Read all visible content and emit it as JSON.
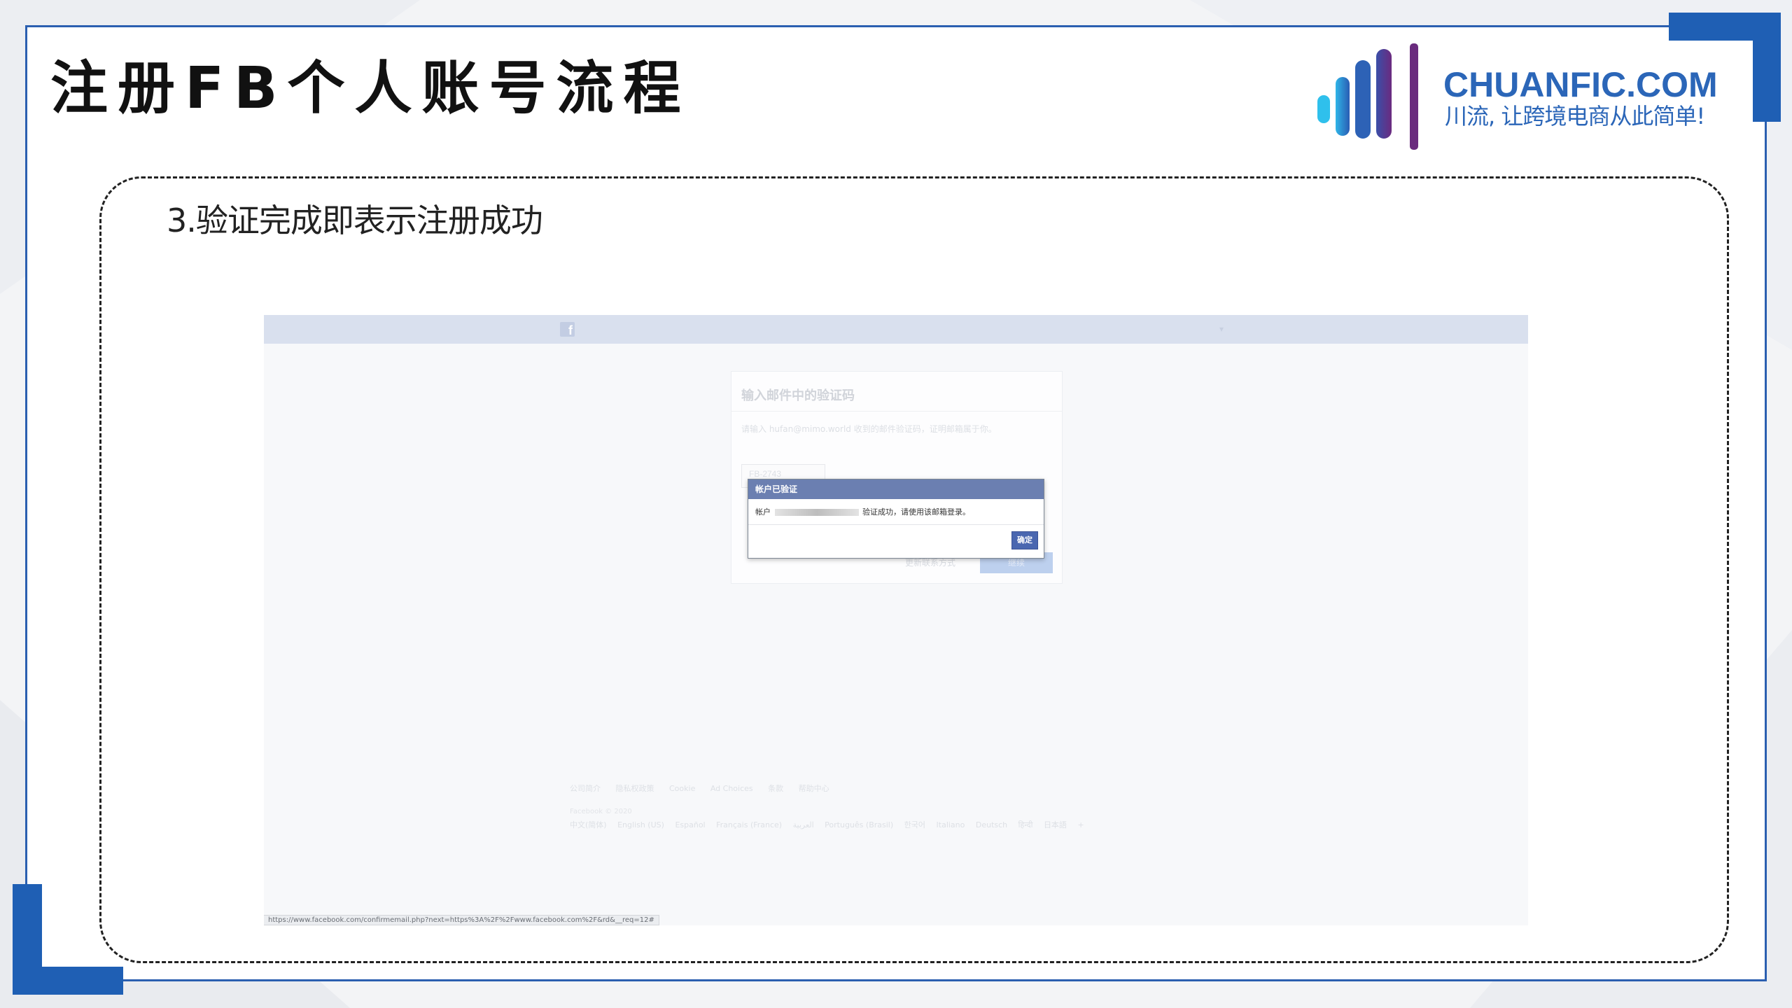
{
  "slide": {
    "title": "注册FB个人账号流程",
    "step": "3.验证完成即表示注册成功"
  },
  "brand": {
    "name": "CHUANFIC.COM",
    "slogan": "川流, 让跨境电商从此简单!",
    "accent_color": "#1f5fb4",
    "logo_icon": "bar-chart-logo-icon"
  },
  "screenshot": {
    "topbar": {
      "logo_icon": "facebook-icon",
      "logo_glyph": "f",
      "menu_icon": "chevron-down-icon",
      "menu_glyph": "▾"
    },
    "card": {
      "title": "输入邮件中的验证码",
      "description": "请输入 hufan@mimo.world 收到的邮件验证码，证明邮箱属于你。",
      "input_value": "FB-2743",
      "link": "更新联系方式",
      "button": "继续"
    },
    "dialog": {
      "title": "帐户已验证",
      "body_prefix": "帐户",
      "body_suffix": "验证成功，请使用该邮箱登录。",
      "confirm_button": "确定",
      "header_color": "#6b7fb1",
      "button_color": "#4a67b0"
    },
    "footer": {
      "links": [
        "公司简介",
        "隐私权政策",
        "Cookie",
        "Ad Choices",
        "条款",
        "帮助中心"
      ],
      "copyright": "Facebook © 2020",
      "languages": [
        "中文(简体)",
        "English (US)",
        "Español",
        "Français (France)",
        "العربية",
        "Português (Brasil)",
        "한국어",
        "Italiano",
        "Deutsch",
        "हिन्दी",
        "日本語"
      ],
      "more": "+"
    },
    "status_url": "https://www.facebook.com/confirmemail.php?next=https%3A%2F%2Fwww.facebook.com%2F&rd&__req=12#"
  }
}
